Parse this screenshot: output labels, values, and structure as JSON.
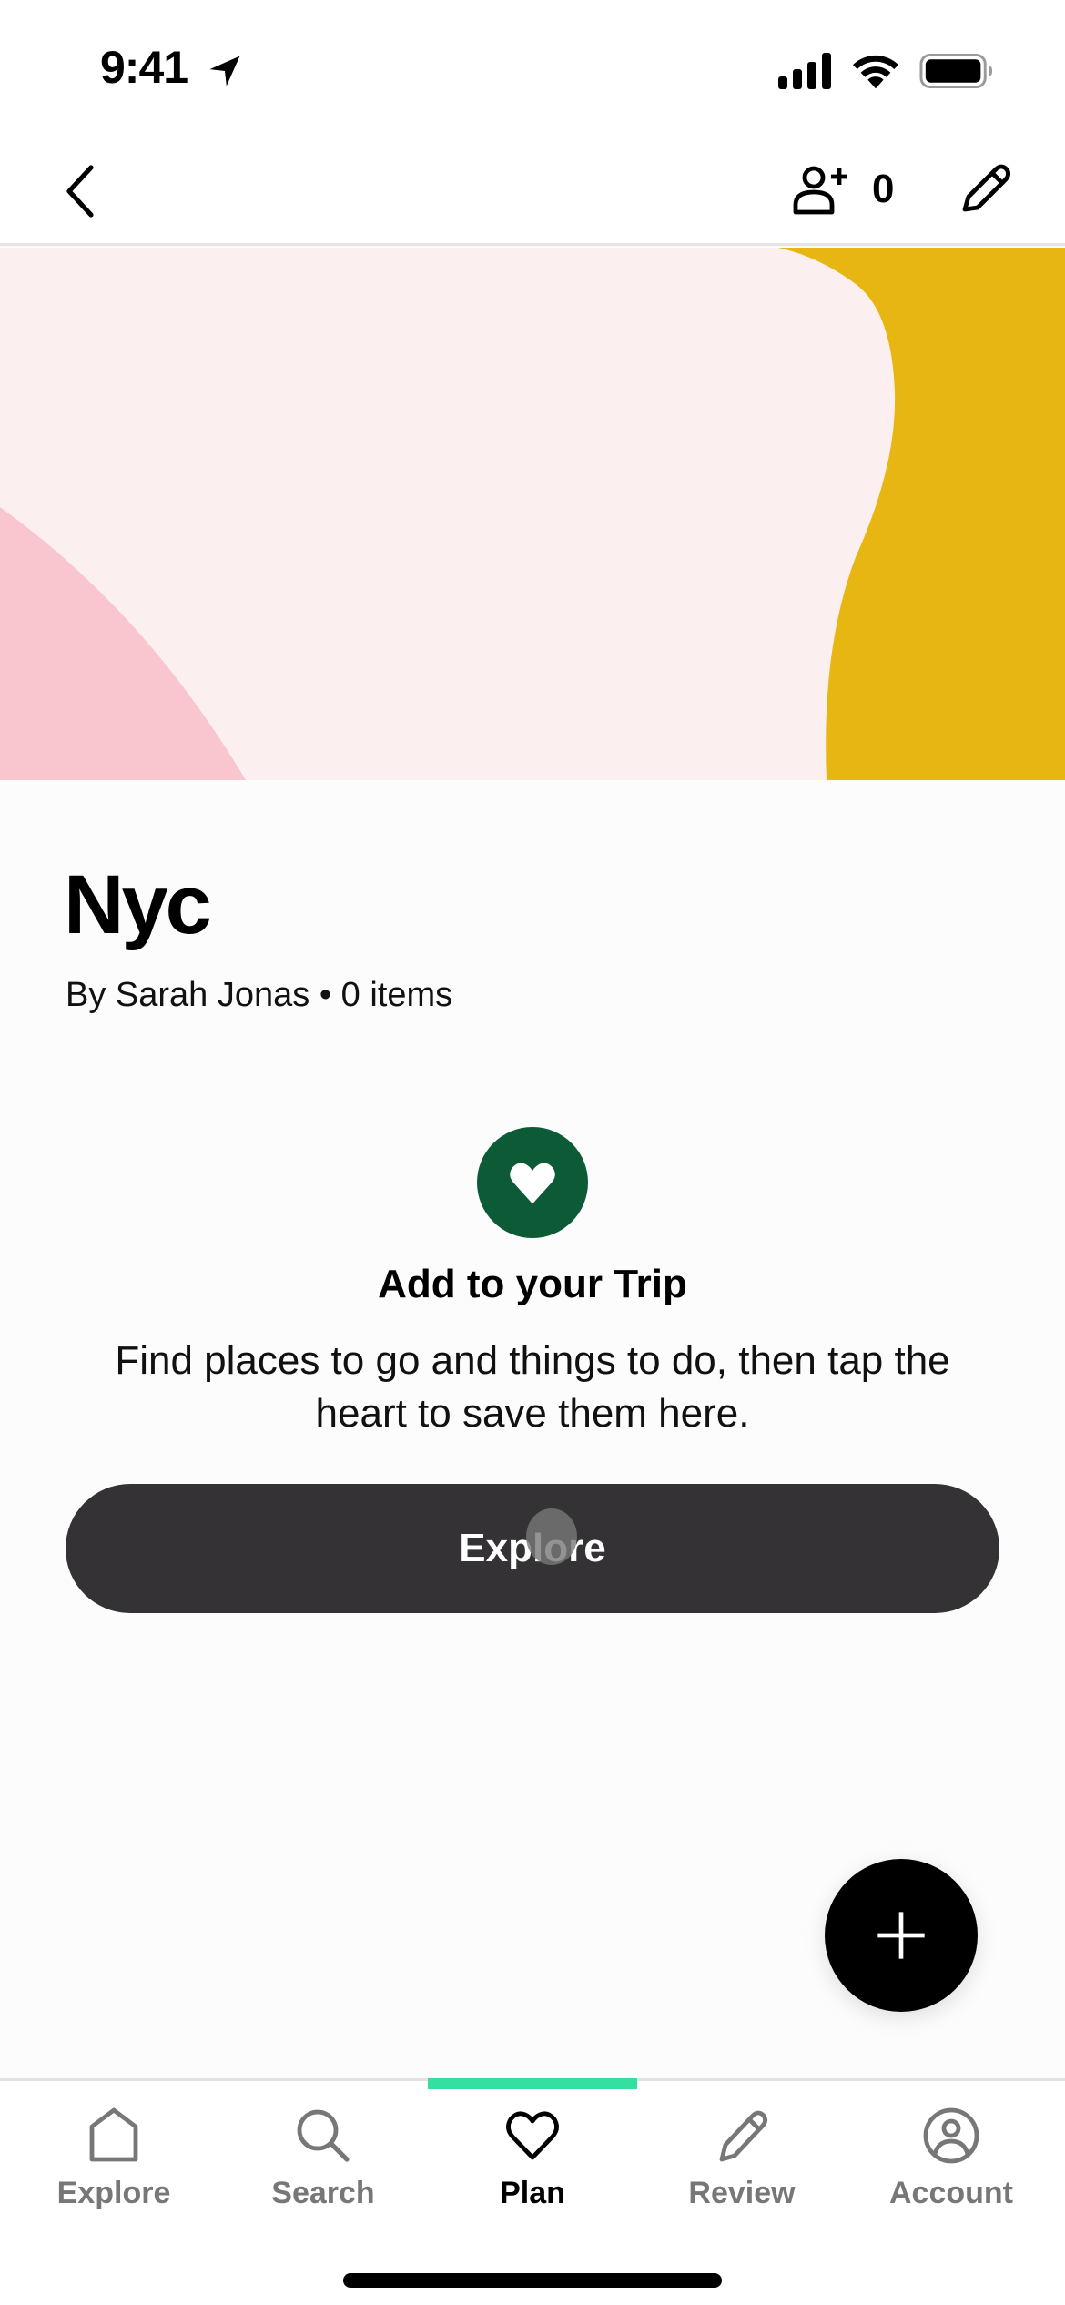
{
  "status_bar": {
    "time": "9:41",
    "icons": [
      "location-arrow-icon",
      "cellular-signal-icon",
      "wifi-icon",
      "battery-icon"
    ]
  },
  "header": {
    "back_icon": "chevron-left-icon",
    "invite_icon": "person-add-icon",
    "collaborator_count": "0",
    "edit_icon": "pencil-icon"
  },
  "hero": {
    "colors": {
      "background": "#fbf0ef",
      "pink_shape": "#f9c6d0",
      "yellow_shape": "#e8b613"
    }
  },
  "trip": {
    "title": "Nyc",
    "meta": "By Sarah Jonas • 0 items"
  },
  "empty_state": {
    "icon": "heart-icon",
    "icon_color": "#0c5b36",
    "title": "Add to your Trip",
    "body": "Find places to go and things to do, then tap the heart to save them here.",
    "button_label": "Explore"
  },
  "fab": {
    "icon": "plus-icon"
  },
  "tab_bar": {
    "active_color": "#34e0a1",
    "tabs": [
      {
        "label": "Explore",
        "icon": "home-icon",
        "active": false
      },
      {
        "label": "Search",
        "icon": "search-icon",
        "active": false
      },
      {
        "label": "Plan",
        "icon": "heart-icon",
        "active": true
      },
      {
        "label": "Review",
        "icon": "pencil-icon",
        "active": false
      },
      {
        "label": "Account",
        "icon": "account-circle-icon",
        "active": false
      }
    ]
  }
}
